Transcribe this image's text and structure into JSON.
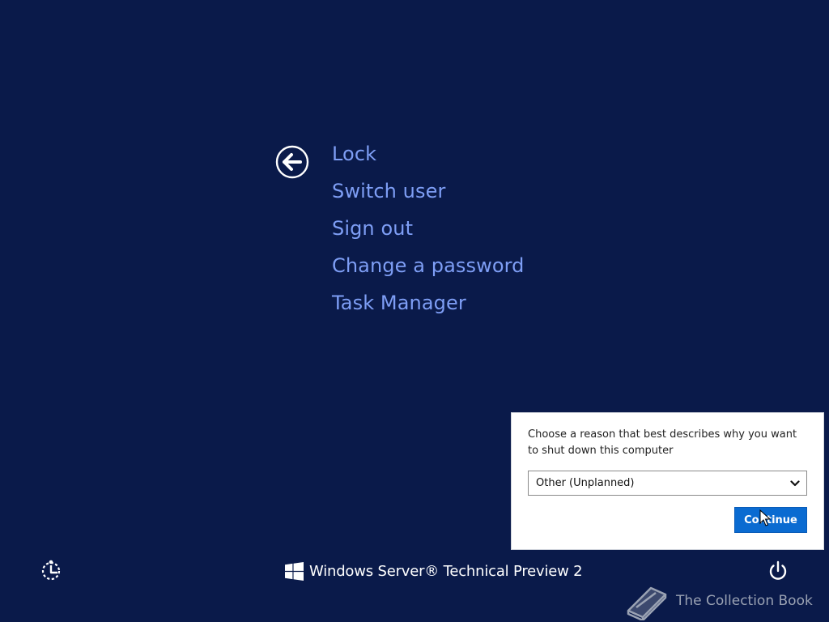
{
  "security_menu": {
    "items": [
      {
        "label": "Lock"
      },
      {
        "label": "Switch user"
      },
      {
        "label": "Sign out"
      },
      {
        "label": "Change a password"
      },
      {
        "label": "Task Manager"
      }
    ]
  },
  "shutdown_dialog": {
    "prompt": "Choose a reason that best describes why you want to shut down this computer",
    "reason_value": "Other (Unplanned)",
    "continue_label": "Continue"
  },
  "footer": {
    "branding_text": "Windows Server® Technical Preview 2",
    "watermark_text": "The Collection Book"
  },
  "icons": {
    "back": "back-arrow-icon",
    "ease_of_access": "ease-of-access-icon",
    "windows_logo": "windows-logo-icon",
    "power": "power-icon",
    "dropdown": "chevron-down-icon",
    "watermark": "book-icon"
  },
  "colors": {
    "background": "#0a1a4a",
    "menu_text": "#7e9ef5",
    "dialog_background": "#ffffff",
    "button_accent": "#0a6bd1",
    "watermark": "#9aa2b3"
  }
}
